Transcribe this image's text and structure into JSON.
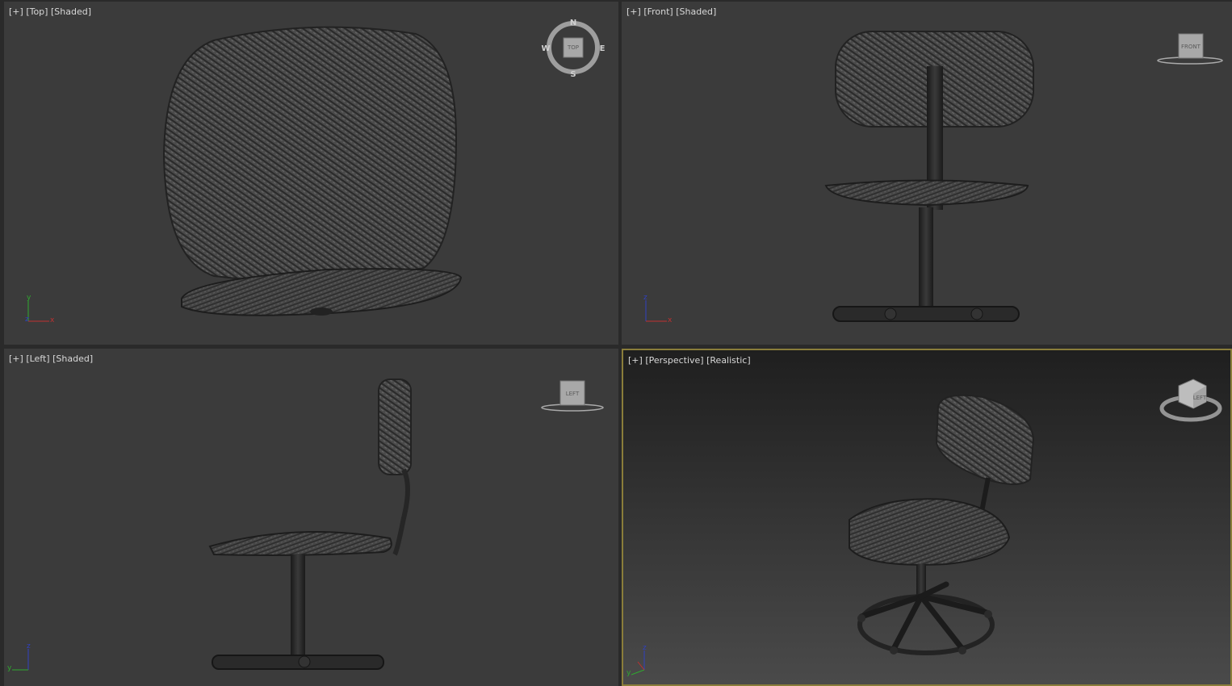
{
  "viewports": {
    "top": {
      "plus": "[+]",
      "view": "[Top]",
      "shading": "[Shaded]",
      "navlabel": "TOP",
      "compass": {
        "n": "N",
        "s": "S",
        "e": "E",
        "w": "W"
      }
    },
    "front": {
      "plus": "[+]",
      "view": "[Front]",
      "shading": "[Shaded]",
      "navlabel": "FRONT"
    },
    "left": {
      "plus": "[+]",
      "view": "[Left]",
      "shading": "[Shaded]",
      "navlabel": "LEFT"
    },
    "persp": {
      "plus": "[+]",
      "view": "[Perspective]",
      "shading": "[Realistic]",
      "navlabel": "LEFT",
      "active": true
    }
  },
  "axes": {
    "x": "x",
    "y": "y",
    "z": "z"
  },
  "colors": {
    "viewport_bg": "#3b3b3b",
    "active_border": "#8a7d3a",
    "fabric": "#444444",
    "metal": "#1e1e1e",
    "axis_x": "#c03030",
    "axis_y": "#2fa82f",
    "axis_z": "#3040c0"
  },
  "icons": [
    "viewcube-icon",
    "compass-icon",
    "axis-tripod-icon"
  ]
}
